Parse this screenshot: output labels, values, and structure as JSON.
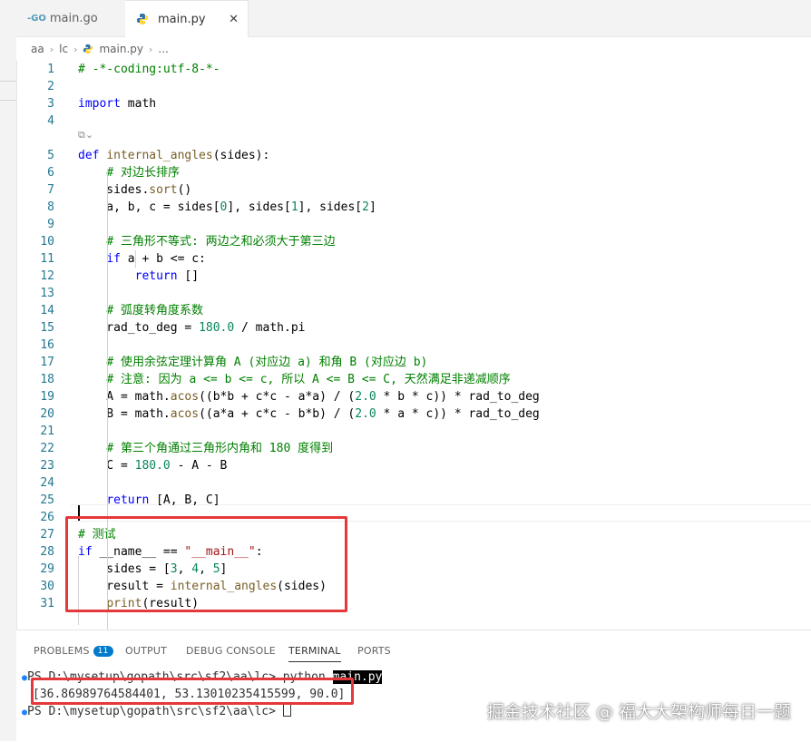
{
  "tabs": [
    {
      "label": "main.go",
      "icon": "go-file-icon"
    },
    {
      "label": "main.py",
      "icon": "python-file-icon",
      "active": true
    }
  ],
  "breadcrumb": {
    "parts": [
      "aa",
      "lc",
      "main.py",
      "..."
    ]
  },
  "code_lines": [
    [
      {
        "t": "# -*-coding:utf-8-*-",
        "c": "cm"
      }
    ],
    [],
    [
      {
        "t": "import",
        "c": "kw"
      },
      {
        "t": " math",
        "c": "df"
      }
    ],
    [],
    [
      {
        "t": "def",
        "c": "kw"
      },
      {
        "t": " ",
        "c": "df"
      },
      {
        "t": "internal_angles",
        "c": "fn"
      },
      {
        "t": "(sides):",
        "c": "df"
      }
    ],
    [
      {
        "t": "    ",
        "c": "df"
      },
      {
        "t": "# 对边长排序",
        "c": "cm"
      }
    ],
    [
      {
        "t": "    sides.",
        "c": "df"
      },
      {
        "t": "sort",
        "c": "fn"
      },
      {
        "t": "()",
        "c": "df"
      }
    ],
    [
      {
        "t": "    a, b, c = sides[",
        "c": "df"
      },
      {
        "t": "0",
        "c": "nm"
      },
      {
        "t": "], sides[",
        "c": "df"
      },
      {
        "t": "1",
        "c": "nm"
      },
      {
        "t": "], sides[",
        "c": "df"
      },
      {
        "t": "2",
        "c": "nm"
      },
      {
        "t": "]",
        "c": "df"
      }
    ],
    [],
    [
      {
        "t": "    ",
        "c": "df"
      },
      {
        "t": "# 三角形不等式: 两边之和必须大于第三边",
        "c": "cm"
      }
    ],
    [
      {
        "t": "    ",
        "c": "df"
      },
      {
        "t": "if",
        "c": "kw"
      },
      {
        "t": " a + b <= c:",
        "c": "df"
      }
    ],
    [
      {
        "t": "        ",
        "c": "df"
      },
      {
        "t": "return",
        "c": "kw"
      },
      {
        "t": " []",
        "c": "df"
      }
    ],
    [],
    [
      {
        "t": "    ",
        "c": "df"
      },
      {
        "t": "# 弧度转角度系数",
        "c": "cm"
      }
    ],
    [
      {
        "t": "    rad_to_deg = ",
        "c": "df"
      },
      {
        "t": "180.0",
        "c": "nm"
      },
      {
        "t": " / math.",
        "c": "df"
      },
      {
        "t": "pi",
        "c": "df"
      }
    ],
    [],
    [
      {
        "t": "    ",
        "c": "df"
      },
      {
        "t": "# 使用余弦定理计算角 A (对应边 a) 和角 B (对应边 b)",
        "c": "cm"
      }
    ],
    [
      {
        "t": "    ",
        "c": "df"
      },
      {
        "t": "# 注意: 因为 a <= b <= c, 所以 A <= B <= C, 天然满足非递减顺序",
        "c": "cm"
      }
    ],
    [
      {
        "t": "    A = math.",
        "c": "df"
      },
      {
        "t": "acos",
        "c": "fn"
      },
      {
        "t": "((b*b + c*c - a*a) / (",
        "c": "df"
      },
      {
        "t": "2.0",
        "c": "nm"
      },
      {
        "t": " * b * c)) * rad_to_deg",
        "c": "df"
      }
    ],
    [
      {
        "t": "    B = math.",
        "c": "df"
      },
      {
        "t": "acos",
        "c": "fn"
      },
      {
        "t": "((a*a + c*c - b*b) / (",
        "c": "df"
      },
      {
        "t": "2.0",
        "c": "nm"
      },
      {
        "t": " * a * c)) * rad_to_deg",
        "c": "df"
      }
    ],
    [],
    [
      {
        "t": "    ",
        "c": "df"
      },
      {
        "t": "# 第三个角通过三角形内角和 180 度得到",
        "c": "cm"
      }
    ],
    [
      {
        "t": "    C = ",
        "c": "df"
      },
      {
        "t": "180.0",
        "c": "nm"
      },
      {
        "t": " - A - B",
        "c": "df"
      }
    ],
    [],
    [
      {
        "t": "    ",
        "c": "df"
      },
      {
        "t": "return",
        "c": "kw"
      },
      {
        "t": " [A, B, C]",
        "c": "df"
      }
    ],
    [],
    [
      {
        "t": "# 测试",
        "c": "cm"
      }
    ],
    [
      {
        "t": "if",
        "c": "kw"
      },
      {
        "t": " __name__ == ",
        "c": "df"
      },
      {
        "t": "\"__main__\"",
        "c": "st"
      },
      {
        "t": ":",
        "c": "df"
      }
    ],
    [
      {
        "t": "    sides = [",
        "c": "df"
      },
      {
        "t": "3",
        "c": "nm"
      },
      {
        "t": ", ",
        "c": "df"
      },
      {
        "t": "4",
        "c": "nm"
      },
      {
        "t": ", ",
        "c": "df"
      },
      {
        "t": "5",
        "c": "nm"
      },
      {
        "t": "]",
        "c": "df"
      }
    ],
    [
      {
        "t": "    result = ",
        "c": "df"
      },
      {
        "t": "internal_angles",
        "c": "fn"
      },
      {
        "t": "(sides)",
        "c": "df"
      }
    ],
    [
      {
        "t": "    ",
        "c": "df"
      },
      {
        "t": "print",
        "c": "fn"
      },
      {
        "t": "(result)",
        "c": "df"
      }
    ]
  ],
  "panel": {
    "tabs": [
      "PROBLEMS",
      "OUTPUT",
      "DEBUG CONSOLE",
      "TERMINAL",
      "PORTS"
    ],
    "problems_count": "11",
    "active_tab": "TERMINAL"
  },
  "terminal": {
    "line1_prompt": "PS D:\\mysetup\\gopath\\src\\sf2\\aa\\lc> ",
    "line1_cmd_a": "python ",
    "line1_cmd_b": "main.py",
    "output": "[36.86989764584401, 53.13010235415599, 90.0]",
    "line3_prompt": "PS D:\\mysetup\\gopath\\src\\sf2\\aa\\lc> "
  },
  "watermark": "掘金技术社区 @ 福大大架构师每日一题",
  "colors": {
    "accent": "#007acc",
    "highlight_box": "#e5383b"
  }
}
